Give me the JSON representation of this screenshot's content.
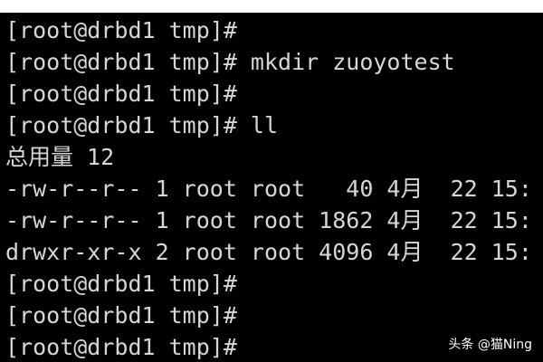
{
  "terminal": {
    "lines": [
      "[root@drbd1 tmp]#",
      "[root@drbd1 tmp]# mkdir zuoyotest",
      "[root@drbd1 tmp]#",
      "[root@drbd1 tmp]# ll",
      "总用量 12",
      "-rw-r--r-- 1 root root   40 4月  22 15:",
      "-rw-r--r-- 1 root root 1862 4月  22 15:",
      "drwxr-xr-x 2 root root 4096 4月  22 15:",
      "[root@drbd1 tmp]#",
      "[root@drbd1 tmp]#",
      "[root@drbd1 tmp]#"
    ],
    "colors": {
      "background": "#000000",
      "text": "#d6d6d6"
    }
  },
  "watermark": {
    "text": "头条 @猫Ning"
  }
}
